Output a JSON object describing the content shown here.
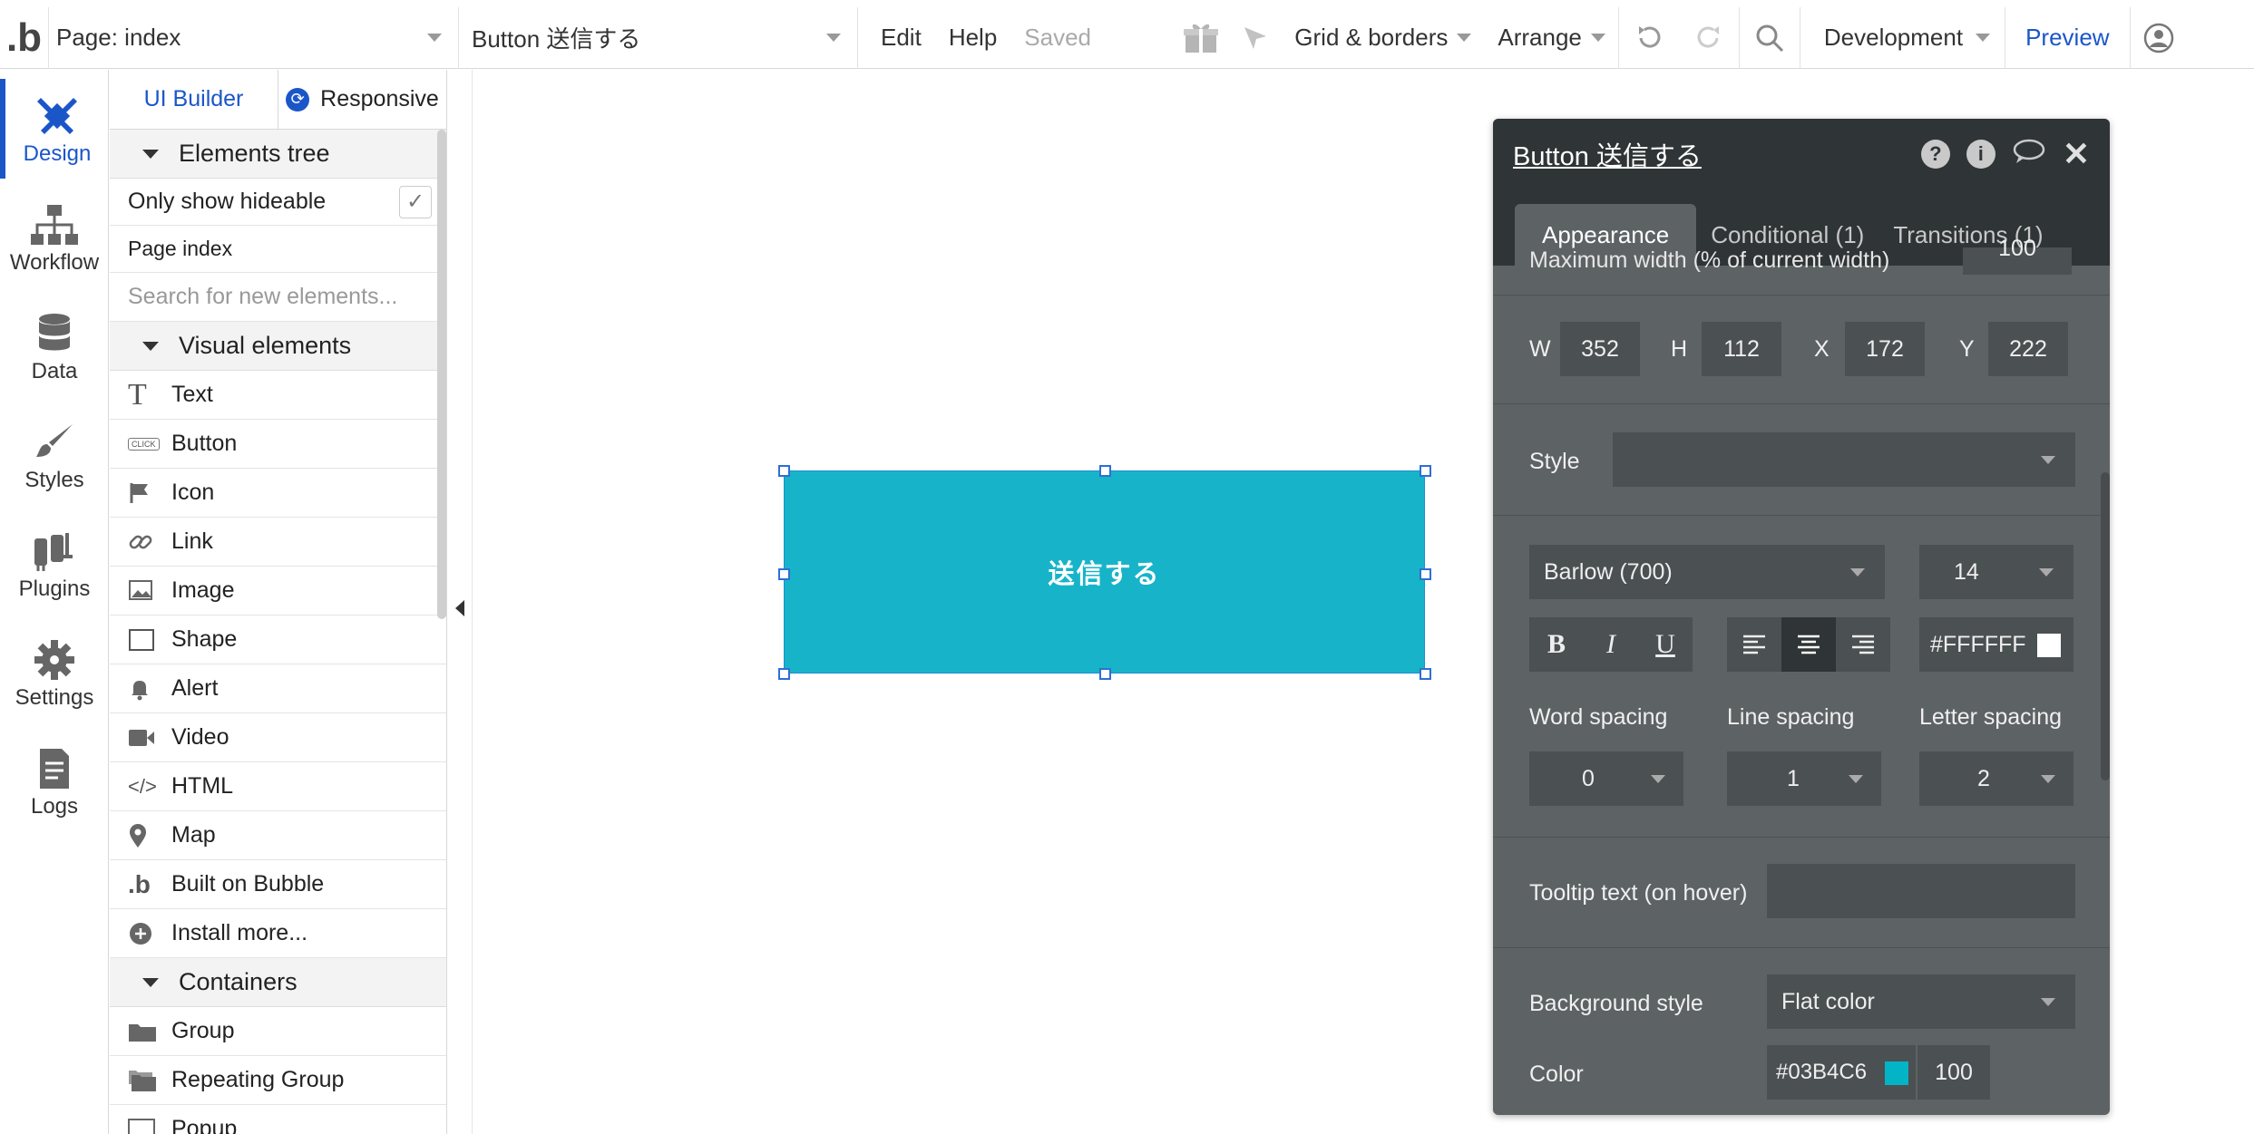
{
  "topbar": {
    "logo": ".b",
    "page_selector": "Page: index",
    "element_selector": "Button 送信する",
    "edit": "Edit",
    "help": "Help",
    "saved": "Saved",
    "grid_borders": "Grid & borders",
    "arrange": "Arrange",
    "environment": "Development",
    "preview": "Preview"
  },
  "rail": {
    "items": [
      {
        "label": "Design",
        "icon": "design-icon"
      },
      {
        "label": "Workflow",
        "icon": "workflow-icon"
      },
      {
        "label": "Data",
        "icon": "database-icon"
      },
      {
        "label": "Styles",
        "icon": "brush-icon"
      },
      {
        "label": "Plugins",
        "icon": "plugins-icon"
      },
      {
        "label": "Settings",
        "icon": "gear-icon"
      },
      {
        "label": "Logs",
        "icon": "document-icon"
      }
    ]
  },
  "panel": {
    "tab_ui_builder": "UI Builder",
    "tab_responsive": "Responsive",
    "elements_tree": "Elements tree",
    "only_show_hideable": "Only show hideable",
    "page_index": "Page index",
    "search_placeholder": "Search for new elements...",
    "visual_elements": "Visual elements",
    "visual_items": [
      "Text",
      "Button",
      "Icon",
      "Link",
      "Image",
      "Shape",
      "Alert",
      "Video",
      "HTML",
      "Map",
      "Built on Bubble",
      "Install more..."
    ],
    "containers": "Containers",
    "container_items": [
      "Group",
      "Repeating Group",
      "Popup"
    ]
  },
  "canvas": {
    "button_text": "送信する",
    "button_color": "#17B4C9"
  },
  "editor": {
    "title": "Button 送信する",
    "tabs": [
      "Appearance",
      "Conditional (1)",
      "Transitions (1)"
    ],
    "cut_off_label": "Maximum width (% of current width)",
    "cut_off_value": "100",
    "w_label": "W",
    "w": "352",
    "h_label": "H",
    "h": "112",
    "x_label": "X",
    "x": "172",
    "y_label": "Y",
    "y": "222",
    "style_label": "Style",
    "font": "Barlow (700)",
    "font_size": "14",
    "bold": "B",
    "italic": "I",
    "underline": "U",
    "text_color": "#FFFFFF",
    "word_spacing_label": "Word spacing",
    "word_spacing": "0",
    "line_spacing_label": "Line spacing",
    "line_spacing": "1",
    "letter_spacing_label": "Letter spacing",
    "letter_spacing": "2",
    "tooltip_label": "Tooltip text (on hover)",
    "bg_style_label": "Background style",
    "bg_style": "Flat color",
    "color_label": "Color",
    "color_hex": "#03B4C6",
    "opacity": "100"
  }
}
